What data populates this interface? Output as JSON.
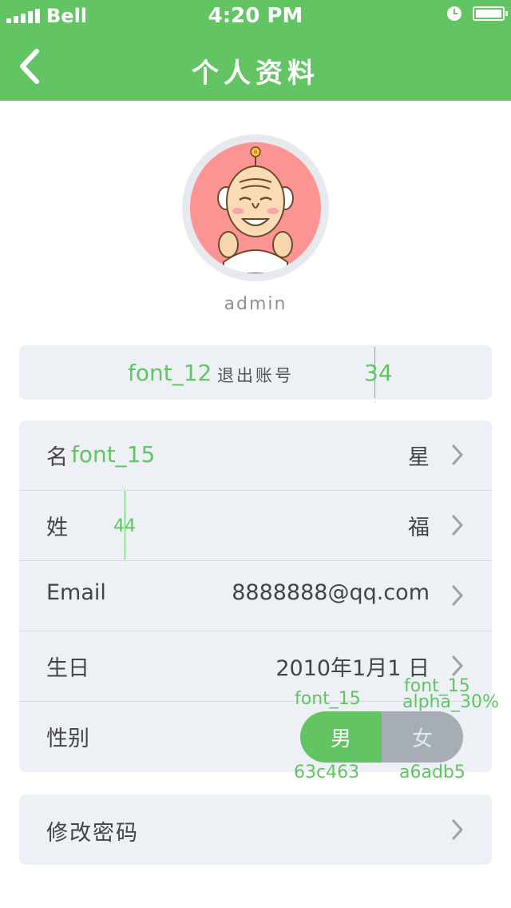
{
  "status_bar": {
    "carrier": "Bell",
    "time": "4:20 PM"
  },
  "nav": {
    "title": "个人资料",
    "back_icon": "chevron-left-icon"
  },
  "profile": {
    "username": "admin"
  },
  "logout": {
    "label": "退出账号"
  },
  "fields": [
    {
      "label": "名",
      "value": "星"
    },
    {
      "label": "姓",
      "value": "福"
    },
    {
      "label": "Email",
      "value": "8888888@qq.com"
    },
    {
      "label": "生日",
      "value": "2010年1月1 日"
    }
  ],
  "gender": {
    "label": "性别",
    "options": [
      "男",
      "女"
    ],
    "selected": "男"
  },
  "password": {
    "label": "修改密码"
  },
  "annotations": {
    "logout_font": "font_12",
    "logout_height": "34",
    "row_font": "font_15",
    "row_height": "44",
    "toggle_font_on": "font_15",
    "toggle_font_off": "font_15",
    "toggle_alpha": "alpha_30%",
    "toggle_color_on": "63c463",
    "toggle_color_off": "a6adb5"
  },
  "colors": {
    "primary": "#63c463",
    "toggle_off": "#a6adb5",
    "card_bg": "#edf0f4",
    "avatar_bg": "#fd9494"
  }
}
